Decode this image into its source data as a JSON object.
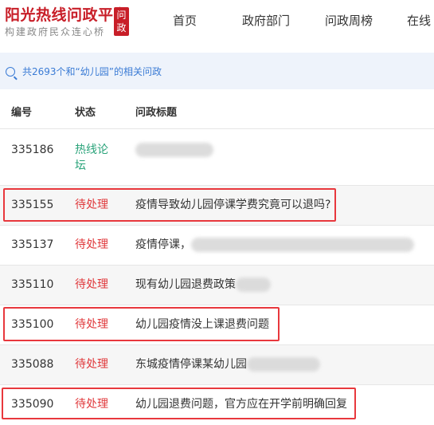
{
  "header": {
    "logo_title": "阳光热线问政平台",
    "logo_subtitle": "构建政府民众连心桥",
    "logo_badge": "问政",
    "nav": [
      "首页",
      "政府部门",
      "问政周榜",
      "在线"
    ]
  },
  "summary": {
    "text": "共2693个和“幼儿园”的相关问政"
  },
  "table": {
    "headers": {
      "id": "编号",
      "status": "状态",
      "title": "问政标题"
    },
    "rows": [
      {
        "id": "335186",
        "status": "热线论坛",
        "status_line1": "热线论",
        "status_line2": "坛",
        "title": ""
      },
      {
        "id": "335155",
        "status": "待处理",
        "title": "疫情导致幼儿园停课学费究竟可以退吗?"
      },
      {
        "id": "335137",
        "status": "待处理",
        "title": "疫情停课，"
      },
      {
        "id": "335110",
        "status": "待处理",
        "title": "现有幼儿园退费政策"
      },
      {
        "id": "335100",
        "status": "待处理",
        "title": "幼儿园疫情没上课退费问题"
      },
      {
        "id": "335088",
        "status": "待处理",
        "title": "东城疫情停课某幼儿园"
      },
      {
        "id": "335090",
        "status": "待处理",
        "title": "幼儿园退费问题，官方应在开学前明确回复"
      }
    ]
  },
  "colors": {
    "brand": "#c81e28",
    "pending": "#e0383b",
    "forum": "#2aa37a",
    "link_blue": "#3a7bd5",
    "highlight_border": "#e8383d"
  }
}
